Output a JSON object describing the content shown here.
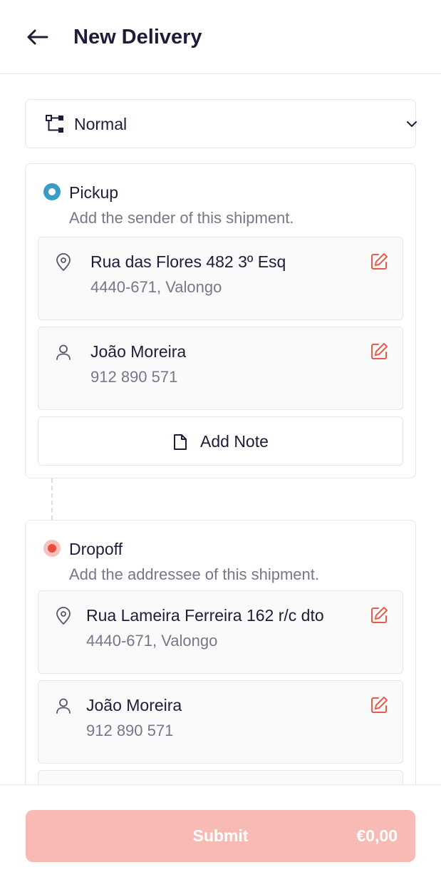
{
  "header": {
    "title": "New Delivery",
    "back_icon": "arrow-left-icon"
  },
  "delivery_type": {
    "selected": "Normal",
    "icon": "flow-tree-icon",
    "chevron": "chevron-down-icon"
  },
  "pickup": {
    "title": "Pickup",
    "subtitle": "Add the sender of this shipment.",
    "address": {
      "line1": "Rua das Flores 482 3º Esq",
      "line2": "4440-671, Valongo"
    },
    "contact": {
      "name": "João Moreira",
      "phone": "912 890 571"
    },
    "add_note_label": "Add Note"
  },
  "dropoff": {
    "title": "Dropoff",
    "subtitle": "Add the addressee of this shipment.",
    "address": {
      "line1": "Rua Lameira Ferreira 162 r/c dto",
      "line2": "4440-671, Valongo"
    },
    "contact": {
      "name": "João Moreira",
      "phone": "912 890 571"
    }
  },
  "footer": {
    "submit_label": "Submit",
    "price": "€0,00"
  },
  "colors": {
    "pickup_accent": "#3a9cc9",
    "dropoff_accent": "#e94b3c",
    "edit_icon": "#ec5a4b",
    "submit_bg": "#f7bab4"
  }
}
